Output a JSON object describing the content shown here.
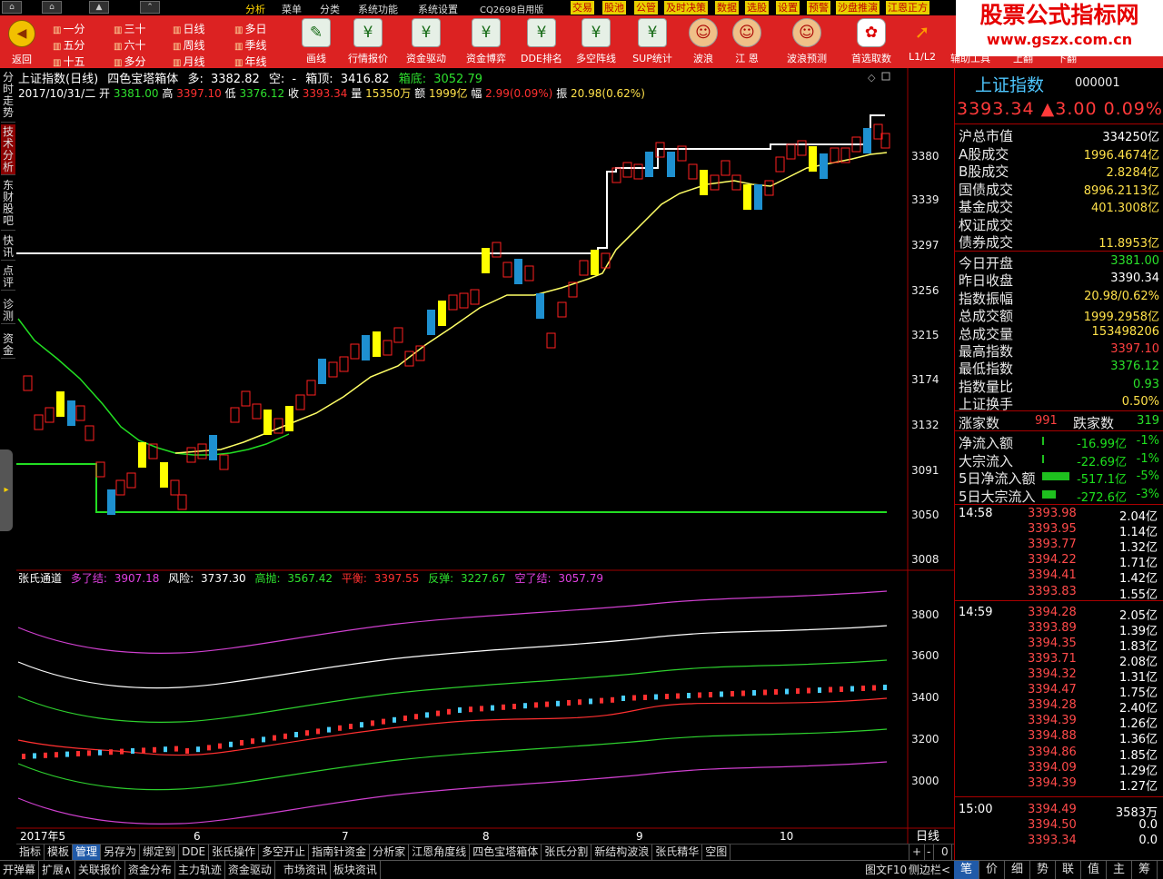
{
  "menubar": {
    "items": [
      "分析",
      "菜单",
      "分类",
      "系统功能",
      "系统设置"
    ],
    "version": "CQ2698自用版",
    "quick": [
      "交易",
      "股池",
      "公管",
      "及时决策",
      "数据",
      "选股",
      "设置",
      "预警",
      "沙盘推演",
      "江恩正方"
    ]
  },
  "toolbar": {
    "back_label": "返回",
    "periods": [
      "一分",
      "三十",
      "日线",
      "多日",
      "五分",
      "六十",
      "周线",
      "季线",
      "十五",
      "多分",
      "月线",
      "年线"
    ],
    "buttons": [
      "画线",
      "行情报价",
      "资金驱动",
      "资金博弈",
      "DDE排名",
      "多空阵线",
      "SUP统计",
      "波浪",
      "江 恩",
      "波浪预测",
      "首选取数",
      "L1/L2",
      "辅助工具",
      "上翻",
      "下翻"
    ]
  },
  "watermark": {
    "title": "股票公式指标网",
    "url": "www.gszx.com.cn"
  },
  "left_tabs": [
    "分时走势",
    "技术分析",
    "东财股吧",
    "快讯",
    "点评",
    "诊测",
    "资金"
  ],
  "main_chart": {
    "title_name": "上证指数(日线)",
    "title_indicator": "四色宝塔箱体",
    "duo_label": "多:",
    "duo_value": "3382.82",
    "kong_label": "空:",
    "kong_value": "-",
    "box_top_label": "箱顶:",
    "box_top_value": "3416.82",
    "box_bottom_label": "箱底:",
    "box_bottom_value": "3052.79",
    "info_date": "2017/10/31/二",
    "open_label": "开",
    "open_value": "3381.00",
    "high_label": "高",
    "high_value": "3397.10",
    "low_label": "低",
    "low_value": "3376.12",
    "close_label": "收",
    "close_value": "3393.34",
    "vol_label": "量",
    "vol_value": "15350万",
    "amt_label": "额",
    "amt_value": "1999亿",
    "chg_label": "幅",
    "chg_value": "2.99(0.09%)",
    "amp_label": "振",
    "amp_value": "20.98(0.62%)",
    "y_ticks": [
      "3380",
      "3339",
      "3297",
      "3256",
      "3215",
      "3174",
      "3132",
      "3091",
      "3050",
      "3008"
    ]
  },
  "sub_chart": {
    "name": "张氏通道",
    "l1_label": "多了结:",
    "l1_value": "3907.18",
    "l2_label": "风险:",
    "l2_value": "3737.30",
    "l3_label": "高抛:",
    "l3_value": "3567.42",
    "l4_label": "平衡:",
    "l4_value": "3397.55",
    "l5_label": "反弹:",
    "l5_value": "3227.67",
    "l6_label": "空了结:",
    "l6_value": "3057.79",
    "y_ticks": [
      "3800",
      "3600",
      "3400",
      "3200",
      "3000"
    ]
  },
  "x_axis": {
    "labels": [
      "2017年5",
      "6",
      "7",
      "8",
      "9",
      "10"
    ],
    "period": "日线"
  },
  "bottom_tabs1": [
    "指标",
    "模板",
    "管理",
    "另存为",
    "绑定到",
    "DDE",
    "张氏操作",
    "多空开止",
    "指南针资金",
    "分析家",
    "江恩角度线",
    "四色宝塔箱体",
    "张氏分割",
    "新结构波浪",
    "张氏精华",
    "空图"
  ],
  "bottom_ctrls": [
    "+",
    "-",
    "0"
  ],
  "bottom_tabs2": [
    "开弹幕",
    "扩展∧",
    "关联报价",
    "资金分布",
    "主力轨迹",
    "资金驱动",
    "市场资讯",
    "板块资讯"
  ],
  "bottom_right": {
    "f10": "图文F10",
    "side": "侧边栏<"
  },
  "right_panel": {
    "name": "上证指数",
    "code": "000001",
    "price": "3393.34",
    "change": "▲3.00",
    "pct": "0.09%",
    "group1": [
      {
        "k": "沪总市值",
        "v": "334250亿",
        "c": "#ffffff"
      },
      {
        "k": "A股成交",
        "v": "1996.4674亿",
        "c": "#ffe14a"
      },
      {
        "k": "B股成交",
        "v": "2.8284亿",
        "c": "#ffe14a"
      },
      {
        "k": "国债成交",
        "v": "8996.2113亿",
        "c": "#ffe14a"
      },
      {
        "k": "基金成交",
        "v": "401.3008亿",
        "c": "#ffe14a"
      },
      {
        "k": "权证成交",
        "v": "",
        "c": "#ffe14a"
      },
      {
        "k": "债券成交",
        "v": "11.8953亿",
        "c": "#ffe14a"
      }
    ],
    "group2": [
      {
        "k": "今日开盘",
        "v": "3381.00",
        "c": "#2ae02a"
      },
      {
        "k": "昨日收盘",
        "v": "3390.34",
        "c": "#ffffff"
      },
      {
        "k": "指数振幅",
        "v": "20.98/0.62%",
        "c": "#ffe14a"
      },
      {
        "k": "总成交额",
        "v": "1999.2958亿",
        "c": "#ffe14a"
      },
      {
        "k": "总成交量",
        "v": "153498206",
        "c": "#ffe14a"
      },
      {
        "k": "最高指数",
        "v": "3397.10",
        "c": "#ff4040"
      },
      {
        "k": "最低指数",
        "v": "3376.12",
        "c": "#2ae02a"
      },
      {
        "k": "指数量比",
        "v": "0.93",
        "c": "#2ae02a"
      },
      {
        "k": "上证换手",
        "v": "0.50%",
        "c": "#ffe14a"
      }
    ],
    "rise_label": "涨家数",
    "rise_value": "991",
    "fall_label": "跌家数",
    "fall_value": "319",
    "flows": [
      {
        "k": "净流入额",
        "v": "-16.99亿",
        "p": "-1%",
        "bar": 0.02
      },
      {
        "k": "大宗流入",
        "v": "-22.69亿",
        "p": "-1%",
        "bar": 0.02
      },
      {
        "k": "5日净流入额",
        "v": "-517.1亿",
        "p": "-5%",
        "bar": 0.3
      },
      {
        "k": "5日大宗流入",
        "v": "-272.6亿",
        "p": "-3%",
        "bar": 0.15
      }
    ],
    "ticks": [
      {
        "t": "14:58",
        "p": "3393.98",
        "v": "2.04亿"
      },
      {
        "t": "",
        "p": "3393.95",
        "v": "1.14亿"
      },
      {
        "t": "",
        "p": "3393.77",
        "v": "1.32亿"
      },
      {
        "t": "",
        "p": "3394.22",
        "v": "1.71亿"
      },
      {
        "t": "",
        "p": "3394.41",
        "v": "1.42亿"
      },
      {
        "t": "",
        "p": "3393.83",
        "v": "1.55亿"
      },
      {
        "t": "14:59",
        "p": "3394.28",
        "v": "2.05亿"
      },
      {
        "t": "",
        "p": "3393.89",
        "v": "1.39亿"
      },
      {
        "t": "",
        "p": "3394.35",
        "v": "1.83亿"
      },
      {
        "t": "",
        "p": "3393.71",
        "v": "2.08亿"
      },
      {
        "t": "",
        "p": "3394.32",
        "v": "1.31亿"
      },
      {
        "t": "",
        "p": "3394.47",
        "v": "1.75亿"
      },
      {
        "t": "",
        "p": "3394.28",
        "v": "2.40亿"
      },
      {
        "t": "",
        "p": "3394.39",
        "v": "1.26亿"
      },
      {
        "t": "",
        "p": "3394.88",
        "v": "1.36亿"
      },
      {
        "t": "",
        "p": "3394.86",
        "v": "1.85亿"
      },
      {
        "t": "",
        "p": "3394.09",
        "v": "1.29亿"
      },
      {
        "t": "",
        "p": "3394.39",
        "v": "1.27亿"
      },
      {
        "t": "15:00",
        "p": "3394.49",
        "v": "3583万"
      },
      {
        "t": "",
        "p": "3394.50",
        "v": "0.0"
      },
      {
        "t": "",
        "p": "3393.34",
        "v": "0.0"
      }
    ],
    "bottom_tabs": [
      "笔",
      "价",
      "细",
      "势",
      "联",
      "值",
      "主",
      "筹"
    ]
  },
  "colors": {
    "up": "#ff3030",
    "down": "#00c8ff",
    "ma": "#ffff66",
    "box": "#ffffff",
    "support": "#22dd22"
  }
}
